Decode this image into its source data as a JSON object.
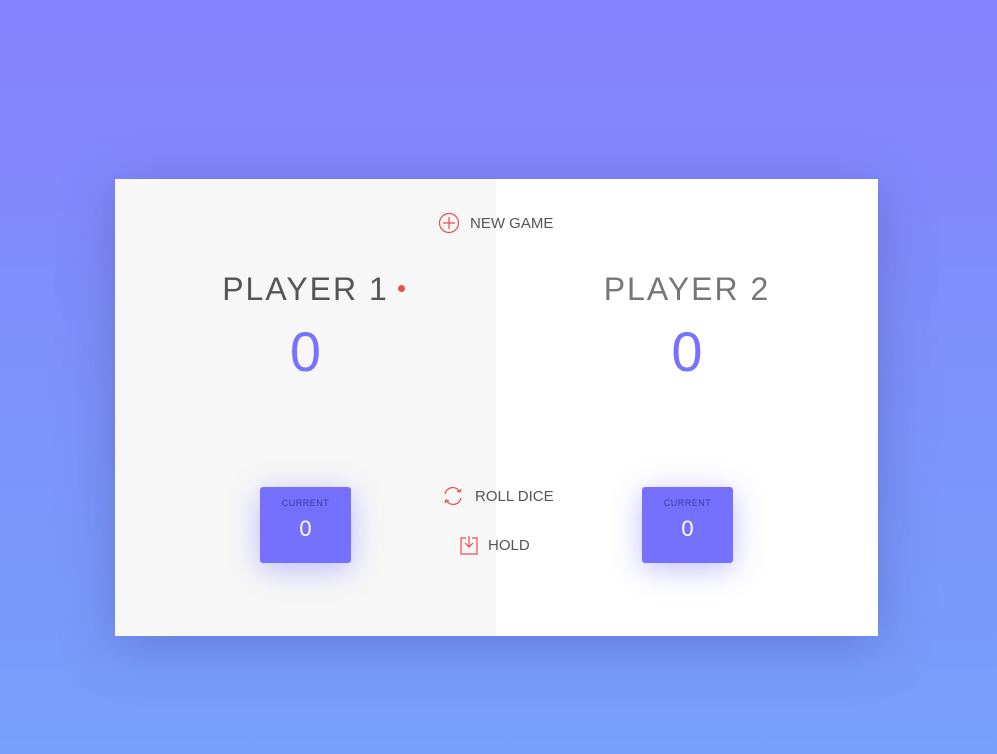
{
  "controls": {
    "new_game": "NEW GAME",
    "roll_dice": "ROLL DICE",
    "hold": "HOLD"
  },
  "players": [
    {
      "name": "PLAYER 1",
      "score": "0",
      "current_label": "CURRENT",
      "current": "0",
      "active": true
    },
    {
      "name": "PLAYER 2",
      "score": "0",
      "current_label": "CURRENT",
      "current": "0",
      "active": false
    }
  ],
  "colors": {
    "accent": "#7570fe",
    "icon": "#eb4d4d"
  }
}
